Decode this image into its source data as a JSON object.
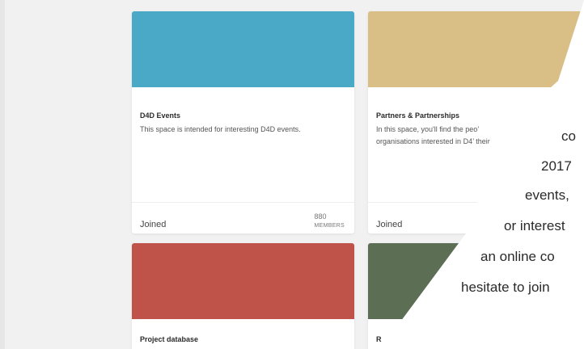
{
  "cards": [
    {
      "title": "D4D Events",
      "description": "This space is intended for interesting D4D events.",
      "status": "Joined",
      "member_count": "880",
      "member_label": "MEMBERS",
      "banner_color": "#4aa9c6"
    },
    {
      "title": "Partners & Partnerships",
      "description": "In this space, you'll find the peo’ organisations interested in D4’ their pitches",
      "status": "Joined",
      "banner_color": "#d9be86"
    },
    {
      "title": "Project database",
      "banner_color": "#bf534a"
    },
    {
      "title": "R",
      "banner_color": "#5c6e54"
    }
  ],
  "overlay": {
    "lines": [
      "co",
      "2017",
      "events,",
      "or interest",
      "an online co",
      "hesitate to join"
    ]
  }
}
